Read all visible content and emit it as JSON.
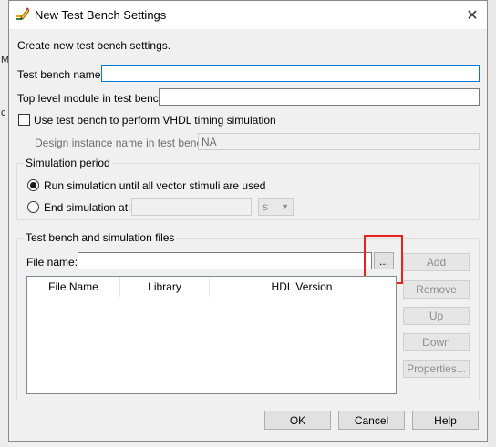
{
  "background": {
    "left_fragment_1": "c",
    "left_fragment_2": "M"
  },
  "window": {
    "title": "New Test Bench Settings",
    "close_glyph": "✕"
  },
  "intro_text": "Create new test bench settings.",
  "test_bench_name": {
    "label": "Test bench name:",
    "value": ""
  },
  "top_level_module": {
    "label": "Top level module in test bench:",
    "value": ""
  },
  "vhdl_timing": {
    "label": "Use test bench to perform VHDL timing simulation",
    "checked": false
  },
  "design_instance": {
    "label": "Design instance name in test bench:",
    "value": "NA"
  },
  "simulation_period": {
    "title": "Simulation period",
    "run_until_label": "Run simulation until all vector stimuli are used",
    "end_at_label": "End simulation at:",
    "end_value": "",
    "unit": "s"
  },
  "files_group": {
    "title": "Test bench and simulation files",
    "file_name_label": "File name:",
    "file_name_value": "",
    "browse_label": "...",
    "columns": [
      "File Name",
      "Library",
      "HDL Version"
    ],
    "rows": []
  },
  "side_buttons": {
    "add": "Add",
    "remove": "Remove",
    "up": "Up",
    "down": "Down",
    "properties": "Properties..."
  },
  "footer": {
    "ok": "OK",
    "cancel": "Cancel",
    "help": "Help"
  },
  "colors": {
    "highlight": "#e8231c",
    "focus_border": "#0078d7"
  },
  "icons": {
    "title_icon": "settings-pencil-icon"
  }
}
